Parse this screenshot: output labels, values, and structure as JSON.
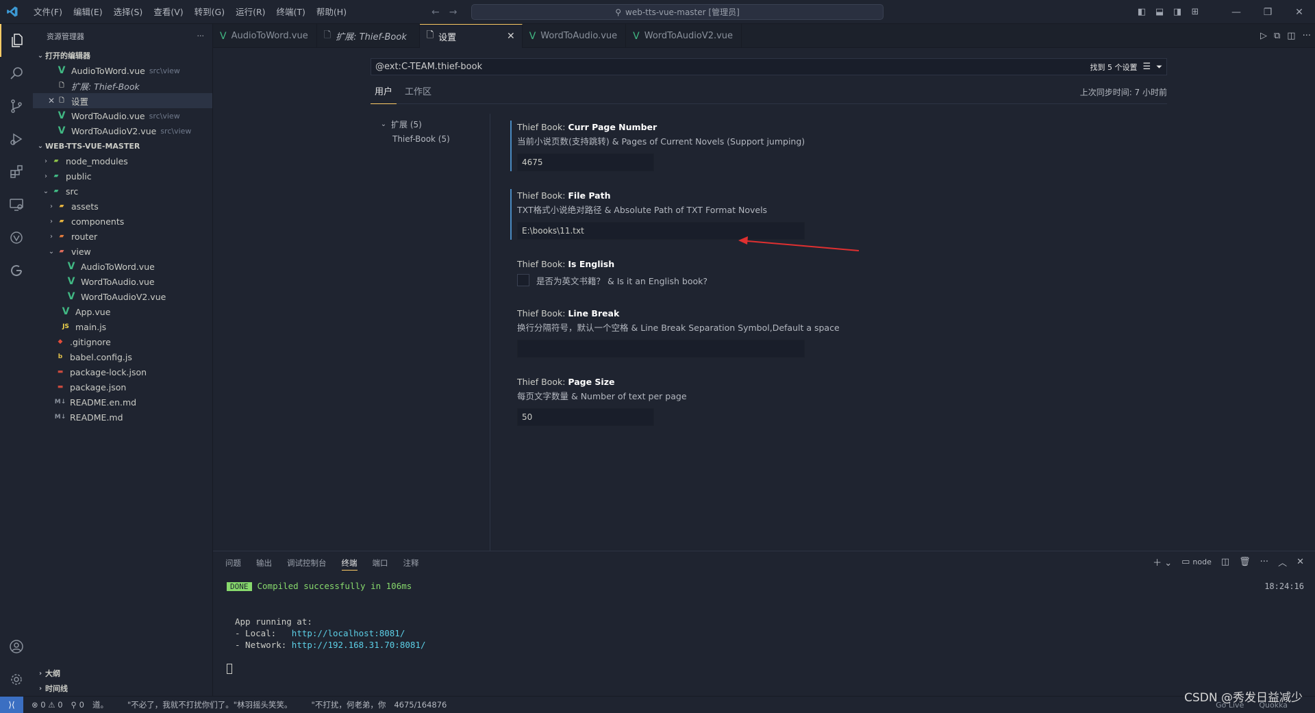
{
  "titlebar": {
    "menu": [
      "文件(F)",
      "编辑(E)",
      "选择(S)",
      "查看(V)",
      "转到(G)",
      "运行(R)",
      "终端(T)",
      "帮助(H)"
    ],
    "search": "web-tts-vue-master [管理员]"
  },
  "sidebar": {
    "title": "资源管理器",
    "more": "···",
    "open_editors_header": "打开的编辑器",
    "open_editors": [
      {
        "name": "AudioToWord.vue",
        "desc": "src\\view"
      },
      {
        "name": "扩展: Thief-Book",
        "desc": ""
      },
      {
        "name": "设置",
        "desc": ""
      },
      {
        "name": "WordToAudio.vue",
        "desc": "src\\view"
      },
      {
        "name": "WordToAudioV2.vue",
        "desc": "src\\view"
      }
    ],
    "project_header": "WEB-TTS-VUE-MASTER",
    "tree": {
      "node_modules": "node_modules",
      "public": "public",
      "src": "src",
      "assets": "assets",
      "components": "components",
      "router": "router",
      "view": "view",
      "view_files": [
        "AudioToWord.vue",
        "WordToAudio.vue",
        "WordToAudioV2.vue"
      ],
      "app": "App.vue",
      "main": "main.js",
      "gitignore": ".gitignore",
      "babel": "babel.config.js",
      "lock": "package-lock.json",
      "pkg": "package.json",
      "readme_en": "README.en.md",
      "readme": "README.md"
    },
    "outline": "大纲",
    "timeline": "时间线"
  },
  "tabs": [
    {
      "label": "AudioToWord.vue"
    },
    {
      "label": "扩展: Thief-Book"
    },
    {
      "label": "设置"
    },
    {
      "label": "WordToAudio.vue"
    },
    {
      "label": "WordToAudioV2.vue"
    }
  ],
  "settings_editor": {
    "search_value": "@ext:C-TEAM.thief-book",
    "found": "找到 5 个设置",
    "scope_tabs": [
      "用户",
      "工作区"
    ],
    "sync": "上次同步时间: 7 小时前",
    "toc_group": "扩展 (5)",
    "toc_item": "Thief-Book (5)",
    "items": [
      {
        "prefix": "Thief Book: ",
        "name": "Curr Page Number",
        "desc": "当前小说页数(支持跳转) & Pages of Current Novels (Support jumping)",
        "value": "4675"
      },
      {
        "prefix": "Thief Book: ",
        "name": "File Path",
        "desc": "TXT格式小说绝对路径 & Absolute Path of TXT Format Novels",
        "value": "E:\\books\\11.txt"
      },
      {
        "prefix": "Thief Book: ",
        "name": "Is English",
        "desc": "是否为英文书籍？ & Is it an English book?"
      },
      {
        "prefix": "Thief Book: ",
        "name": "Line Break",
        "desc": "换行分隔符号，默认一个空格 & Line Break Separation Symbol,Default a space",
        "value": ""
      },
      {
        "prefix": "Thief Book: ",
        "name": "Page Size",
        "desc": "每页文字数量 & Number of text per page",
        "value": "50"
      }
    ]
  },
  "panel": {
    "tabs": [
      "问题",
      "输出",
      "调试控制台",
      "终端",
      "端口",
      "注释"
    ],
    "shell": "node",
    "time": "18:24:16",
    "done": "DONE",
    "compiled": "Compiled successfully in 106ms",
    "running": "App running at:",
    "local_label": "- Local:   ",
    "local_url": "http://localhost:8081/",
    "network_label": "- Network: ",
    "network_url": "http://192.168.31.70:8081/"
  },
  "statusbar": {
    "errors": "⊗ 0 ⚠ 0",
    "ports": "⚲ 0",
    "t1": "道。",
    "t2": "\"不必了，我就不打扰你们了。\"林羽摇头笑笑。",
    "t3": "\"不打扰，何老弟，你",
    "page": "4675/164876",
    "golive": "Go Live",
    "quokka": "Quokka",
    "watermark": "CSDN @秀发日益减少"
  },
  "colors": {
    "accent": "#ffcc66",
    "vue": "#41b883",
    "arrow": "#e03030",
    "focus": "#4a8ac2"
  }
}
